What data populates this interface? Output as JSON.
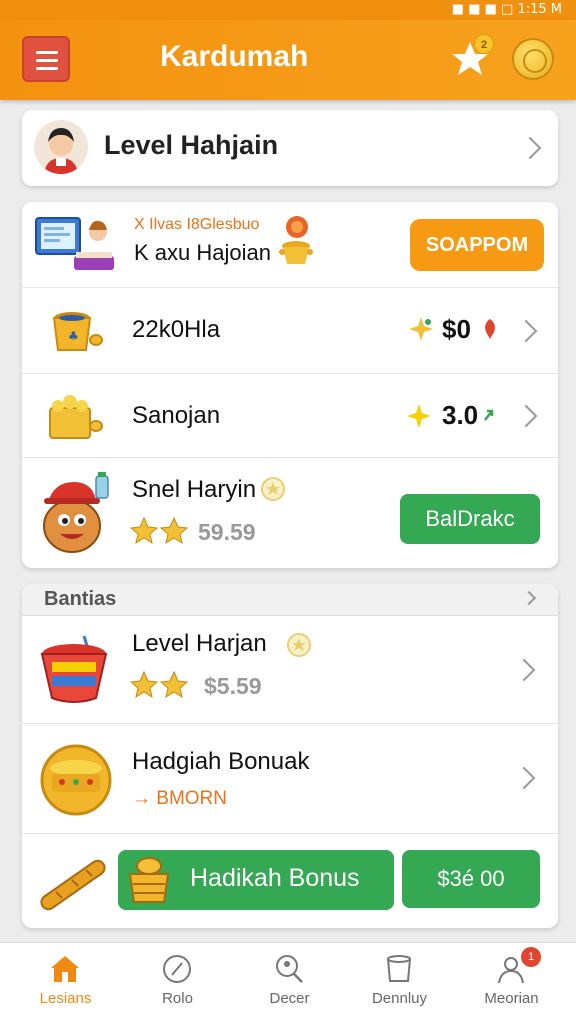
{
  "status_bar": {
    "text": "■ ■ ■  □ 1:15 M"
  },
  "app": {
    "title": "Kardumah",
    "star_badge": "2"
  },
  "level": {
    "title": "Level Hahjain"
  },
  "promo": {
    "line1": "X Ilvas I8Glesbuo",
    "line2": "K axu Hajoian",
    "button": "SOAPPOM"
  },
  "items": [
    {
      "label": "22k0Hla",
      "price": "$0"
    },
    {
      "label": "Sanojan",
      "price": "3.0"
    }
  ],
  "snel": {
    "title": "Snel Haryin",
    "price": "59.59",
    "button": "BalDrakc"
  },
  "section": {
    "title": "Bantias",
    "item1": {
      "title": "Level Harjan",
      "price": "$5.59"
    },
    "item2": {
      "title": "Hadgiah Bonuak",
      "subtitle": "→ BMORN"
    },
    "banner": {
      "label": "Hadikah Bonus",
      "button": "$3é 00"
    }
  },
  "nav": [
    {
      "label": "Lesians",
      "icon": "home-icon",
      "active": true
    },
    {
      "label": "Rolo",
      "icon": "compass-icon"
    },
    {
      "label": "Decer",
      "icon": "search-person-icon"
    },
    {
      "label": "Dennluy",
      "icon": "cup-icon"
    },
    {
      "label": "Meorian",
      "icon": "profile-icon",
      "badge": "1"
    }
  ],
  "colors": {
    "accent": "#f59a12",
    "green": "#34a853",
    "active_nav": "#f08a10"
  }
}
